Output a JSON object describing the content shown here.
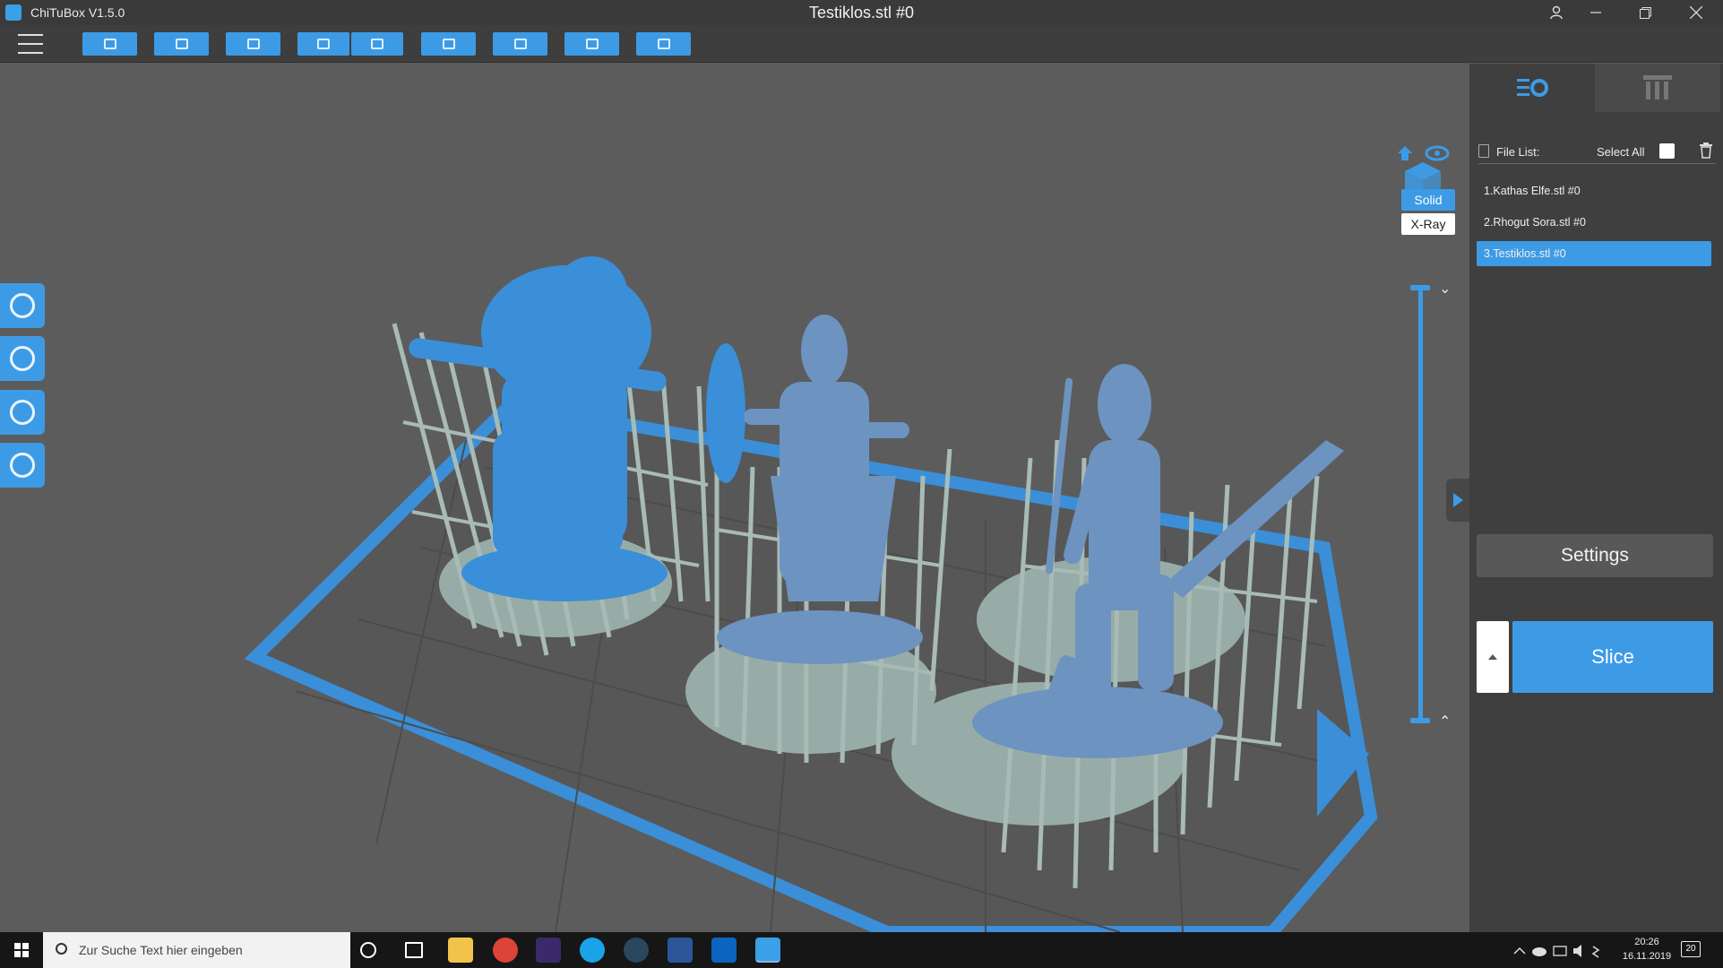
{
  "window": {
    "app_title": "ChiTuBox V1.5.0",
    "document_title": "Testiklos.stl #0",
    "controls": [
      "user-icon",
      "minimize-icon",
      "restore-icon",
      "close-icon"
    ]
  },
  "toolbar": {
    "buttons": [
      {
        "name": "open-file",
        "icon": "folder-icon"
      },
      {
        "name": "save",
        "icon": "save-icon"
      },
      {
        "name": "project",
        "icon": "frame-icon"
      },
      {
        "name": "undo",
        "icon": "undo-icon"
      },
      {
        "name": "redo",
        "icon": "redo-icon"
      },
      {
        "name": "clipboard",
        "icon": "clipboard-icon"
      },
      {
        "name": "arrange",
        "icon": "arrange-icon"
      },
      {
        "name": "hollow",
        "icon": "hollow-icon"
      },
      {
        "name": "settings",
        "icon": "target-icon"
      }
    ]
  },
  "left_tools": [
    {
      "name": "move",
      "icon": "move-icon"
    },
    {
      "name": "rotate",
      "icon": "rotate-icon"
    },
    {
      "name": "scale",
      "icon": "scale-icon"
    },
    {
      "name": "mirror",
      "icon": "mirror-icon"
    }
  ],
  "view_mode": {
    "solid": "Solid",
    "xray": "X-Ray",
    "selected": "Solid"
  },
  "panel": {
    "file_list_label": "File List:",
    "select_all_label": "Select All",
    "files": [
      {
        "label": "1.Kathas Elfe.stl #0",
        "selected": false
      },
      {
        "label": "2.Rhogut Sora.stl #0",
        "selected": false
      },
      {
        "label": "3.Testiklos.stl #0",
        "selected": true
      }
    ],
    "settings_label": "Settings",
    "slice_label": "Slice"
  },
  "taskbar": {
    "search_placeholder": "Zur Suche Text hier eingeben",
    "time": "20:26",
    "date": "16.11.2019",
    "notification_count": "20"
  },
  "colors": {
    "accent": "#3d9be6",
    "model_selected": "#3a8fd8",
    "model": "#6d93c0",
    "supports": "#9fb3ae",
    "build_plate_border": "#3a8fd8"
  }
}
